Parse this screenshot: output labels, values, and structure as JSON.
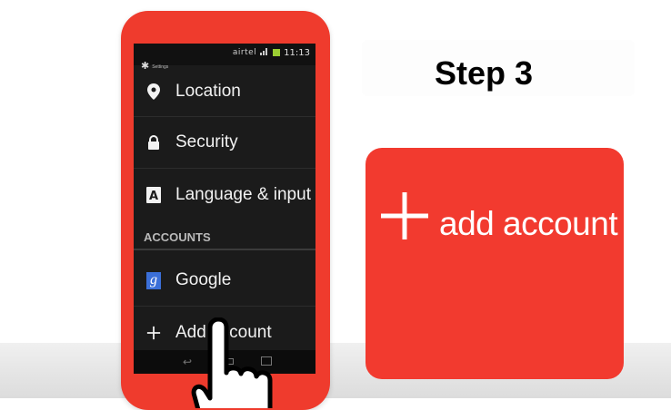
{
  "phone": {
    "status_bar": {
      "carrier": "airtel",
      "time": "11:13"
    },
    "screen_title": "Settings",
    "items": [
      {
        "label": "Location",
        "icon": "location-pin-icon"
      },
      {
        "label": "Security",
        "icon": "lock-icon"
      },
      {
        "label": "Language & input",
        "icon": "keyboard-a-icon"
      }
    ],
    "section_header": "ACCOUNTS",
    "accounts": [
      {
        "label": "Google",
        "icon": "google-g-icon"
      },
      {
        "label": "Add account",
        "icon": "plus-icon"
      }
    ]
  },
  "step_title": "Step 3",
  "callout": {
    "label": "add account",
    "icon": "plus-icon",
    "color": "#f23a2f"
  },
  "colors": {
    "phone_body": "#ef3b2d",
    "screen_bg": "#1b1b1b",
    "google_blue": "#3b6fd8"
  }
}
